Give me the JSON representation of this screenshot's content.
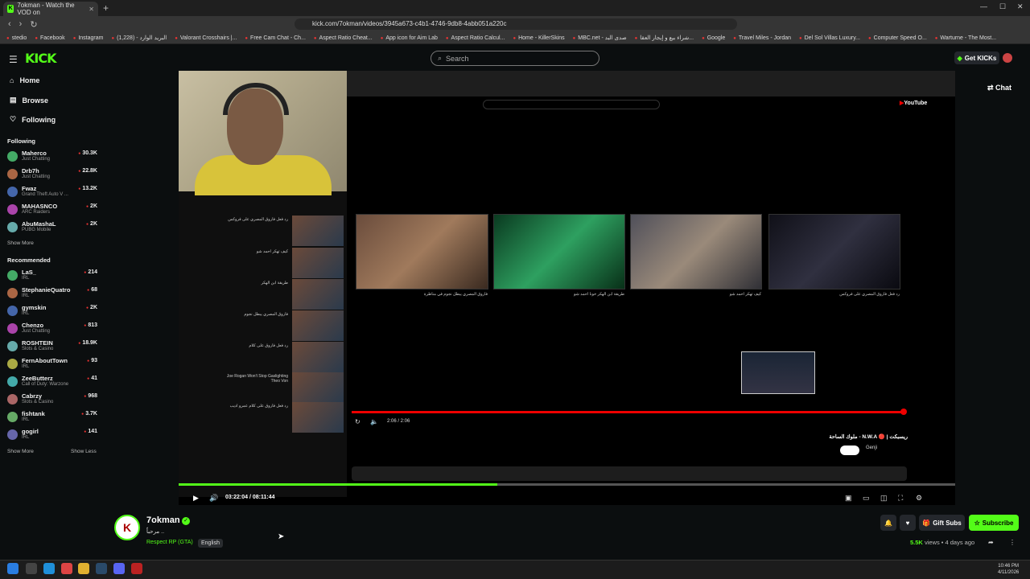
{
  "browser": {
    "tab_title": "7okman - Watch the VOD on",
    "url": "kick.com/7okman/videos/3945a673-c4b1-4746-9db8-4abb051a220c",
    "bookmarks": [
      "stedio",
      "Facebook",
      "Instagram",
      "البريد الوارد - (1,228)",
      "Valorant Crosshairs |...",
      "Free Cam Chat - Ch...",
      "Aspect Ratio Cheat...",
      "App icon for Aim Lab",
      "Aspect Ratio Calcul...",
      "Home - KillerSkins",
      "MBC.net - صدى البد",
      "شراء بيع و إيجار العقا...",
      "Google",
      "Travel Miles - Jordan",
      "Del Sol Villas Luxury...",
      "Computer Speed O...",
      "Warturne - The Most..."
    ]
  },
  "header": {
    "logo": "KICK",
    "search_placeholder": "Search",
    "get_kicks": "Get KICKs",
    "chat": "Chat"
  },
  "sidebar": {
    "nav": [
      {
        "label": "Home",
        "icon": "home-icon"
      },
      {
        "label": "Browse",
        "icon": "browse-icon"
      },
      {
        "label": "Following",
        "icon": "heart-icon"
      }
    ],
    "following_title": "Following",
    "following": [
      {
        "name": "Maherco",
        "category": "Just Chatting",
        "viewers": "30.3K"
      },
      {
        "name": "Drb7h",
        "category": "Just Chatting",
        "viewers": "22.8K"
      },
      {
        "name": "Fwaz",
        "category": "Grand Theft Auto V ...",
        "viewers": "13.2K"
      },
      {
        "name": "MAHASNCO",
        "category": "ARC Raiders",
        "viewers": "2K"
      },
      {
        "name": "AbuMashaL",
        "category": "PUBG Mobile",
        "viewers": "2K"
      }
    ],
    "show_more_1": "Show More",
    "recommended_title": "Recommended",
    "recommended": [
      {
        "name": "LaS_",
        "category": "IRL",
        "viewers": "214"
      },
      {
        "name": "StephanieQuatro",
        "category": "IRL",
        "viewers": "68"
      },
      {
        "name": "gymskin",
        "category": "IRL",
        "viewers": "2K"
      },
      {
        "name": "Chenzo",
        "category": "Just Chatting",
        "viewers": "813"
      },
      {
        "name": "ROSHTEIN",
        "category": "Slots & Casino",
        "viewers": "18.9K"
      },
      {
        "name": "FernAboutTown",
        "category": "IRL",
        "viewers": "93"
      },
      {
        "name": "ZeeButterz",
        "category": "Call of Duty: Warzone",
        "viewers": "41"
      },
      {
        "name": "Cabrzy",
        "category": "Slots & Casino",
        "viewers": "968"
      },
      {
        "name": "fishtank",
        "category": "IRL",
        "viewers": "3.7K"
      },
      {
        "name": "gogirl",
        "category": "IRL",
        "viewers": "141"
      }
    ],
    "show_more_2": "Show More",
    "show_less": "Show Less"
  },
  "player": {
    "time": "03:22:04 / 08:11:44",
    "progress": 0.41,
    "embedded": {
      "yt_time": "2:06 / 2:06",
      "video_title": "ملوك الساحة - N.W.A 🔴 | ريسبكت",
      "channel": "Genji",
      "list_titles": [
        "رد فعل فاروق المصري على فروكس",
        "كيف تهكر احمد شو",
        "طريقة ابن الهكر",
        "فاروق المصري يبطل نجوم",
        "رد فعل فاروق على كلام",
        "Joe Rogan Won't Stop Gaslighting Theo Von",
        "رد فعل فاروق على كلام عمرو اديب"
      ],
      "grid_titles": [
        "فاروق المصري يبطل نجوم في مناظرة",
        "طريقة ابن الهكر خونا احمد شو",
        "كيف تهكر احمد شو",
        "رد فعل فاروق المصري على فروكس"
      ]
    }
  },
  "channel": {
    "name": "7okman",
    "subtitle": "مرحباً ..",
    "category": "Respect RP (GTA)",
    "language": "English",
    "views": "5.5K",
    "views_label": "views",
    "age": "4 days ago",
    "gift_subs": "Gift Subs",
    "subscribe": "Subscribe"
  },
  "taskbar": {
    "time": "10:46 PM",
    "date": "4/11/2026"
  }
}
